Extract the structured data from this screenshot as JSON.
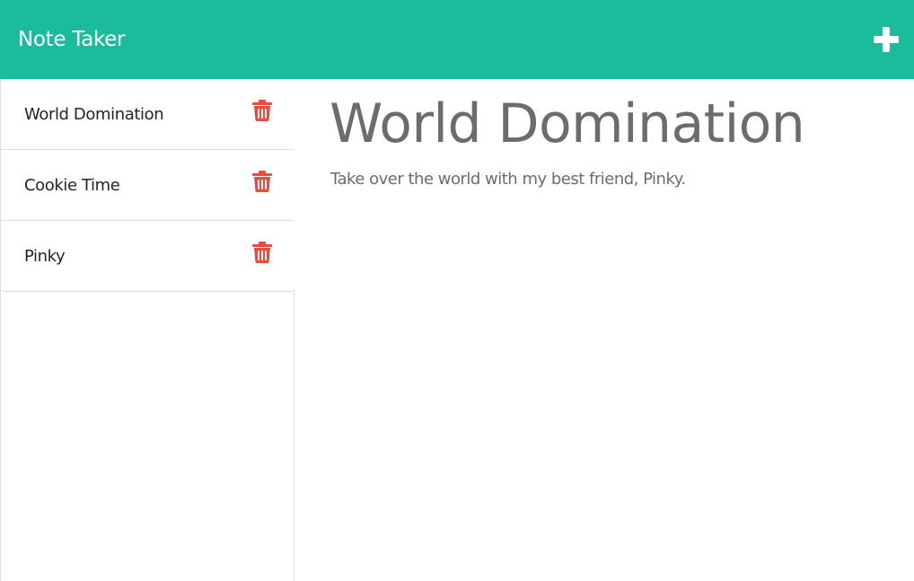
{
  "app": {
    "title": "Note Taker",
    "accent_color": "#1abc9c",
    "new_note_icon": "plus-icon"
  },
  "sidebar": {
    "notes": [
      {
        "title": "World Domination",
        "icon": "trash-icon"
      },
      {
        "title": "Cookie Time",
        "icon": "trash-icon"
      },
      {
        "title": "Pinky",
        "icon": "trash-icon"
      }
    ],
    "delete_color": "#e74c3c"
  },
  "main": {
    "note_title": "World Domination",
    "note_text": "Take over the world with my best friend, Pinky."
  }
}
